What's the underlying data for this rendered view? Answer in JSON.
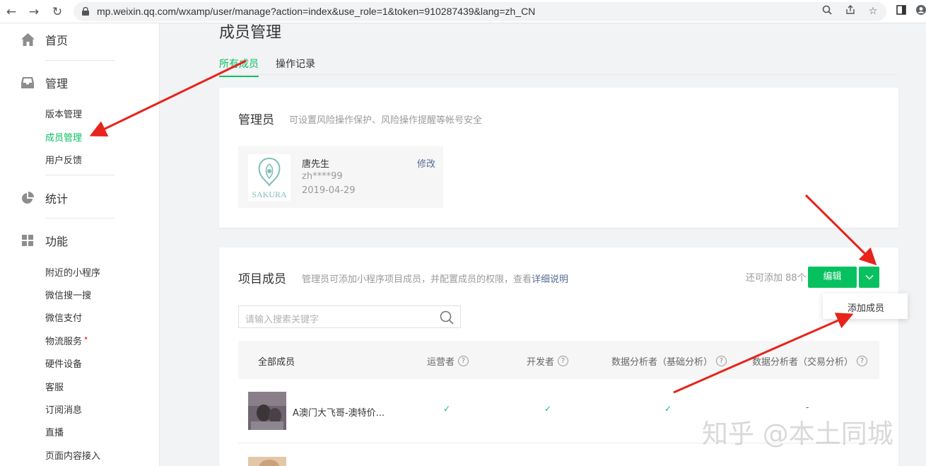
{
  "browser": {
    "url": "mp.weixin.qq.com/wxamp/user/manage?action=index&use_role=1&token=910287439&lang=zh_CN",
    "icons": [
      "back-arrow",
      "forward-arrow",
      "reload",
      "lock",
      "zoom",
      "share",
      "bookmark-star",
      "sidebar-toggle",
      "profile"
    ]
  },
  "sidebar": {
    "home": "首页",
    "manage": "管理",
    "manage_items": [
      "版本管理",
      "成员管理",
      "用户反馈"
    ],
    "stats": "统计",
    "features": "功能",
    "feature_items": [
      "附近的小程序",
      "微信搜一搜",
      "微信支付",
      "物流服务",
      "硬件设备",
      "客服",
      "订阅消息",
      "直播",
      "页面内容接入"
    ],
    "new_dot": "•"
  },
  "page": {
    "title": "成员管理",
    "tabs": [
      "所有成员",
      "操作记录"
    ]
  },
  "admin": {
    "title": "管理员",
    "subtitle": "可设置风险操作保护、风险操作提醒等帐号安全",
    "logo_text": "SAKURA",
    "name": "唐先生",
    "wechat_id": "zh****99",
    "date": "2019-04-29",
    "edit": "修改"
  },
  "members": {
    "title": "项目成员",
    "subtitle": "管理员可添加小程序项目成员，并配置成员的权限，查看",
    "subtitle_link": "详细说明",
    "quota": "还可添加 88个",
    "edit_button": "编辑",
    "dropdown_item": "添加成员",
    "search_placeholder": "请输入搜索关键字",
    "columns": [
      "全部成员",
      "运营者",
      "开发者",
      "数据分析者（基础分析）",
      "数据分析者（交易分析）"
    ],
    "rows": [
      {
        "name": "A澳门大飞哥-澳特价...",
        "operator": "✓",
        "developer": "✓",
        "data_basic": "✓",
        "data_trade": "-"
      }
    ]
  },
  "watermark": "知乎 @本土同城",
  "colors": {
    "accent": "#07c160",
    "link": "#576b95",
    "annotation_arrow": "#e8231b"
  }
}
